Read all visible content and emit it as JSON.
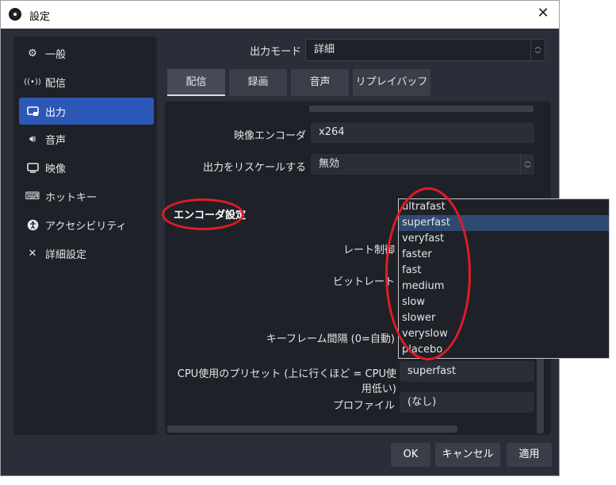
{
  "window": {
    "title": "設定"
  },
  "sidebar": {
    "items": [
      {
        "label": "一般",
        "icon": "gear-icon"
      },
      {
        "label": "配信",
        "icon": "broadcast-icon"
      },
      {
        "label": "出力",
        "icon": "output-icon",
        "active": true
      },
      {
        "label": "音声",
        "icon": "speaker-icon"
      },
      {
        "label": "映像",
        "icon": "monitor-icon"
      },
      {
        "label": "ホットキー",
        "icon": "keyboard-icon"
      },
      {
        "label": "アクセシビリティ",
        "icon": "accessibility-icon"
      },
      {
        "label": "詳細設定",
        "icon": "tools-icon"
      }
    ]
  },
  "output_mode": {
    "label": "出力モード",
    "value": "詳細"
  },
  "tabs": [
    "配信",
    "録画",
    "音声",
    "リプレイバッファ"
  ],
  "settings": {
    "video_encoder": {
      "label": "映像エンコーダ",
      "value": "x264"
    },
    "rescale": {
      "label": "出力をリスケールする",
      "value": "無効"
    },
    "encoder_section": "エンコーダ設定",
    "rate_control": {
      "label": "レート制御"
    },
    "bitrate": {
      "label": "ビットレート"
    },
    "keyframe": {
      "label": "キーフレーム間隔 (0=自動)"
    },
    "cpu_preset": {
      "label": "CPU使用のプリセット (上に行くほど = CPU使用低い)",
      "value": "superfast"
    },
    "profile": {
      "label": "プロファイル",
      "value": "(なし)"
    }
  },
  "preset_dropdown": {
    "options": [
      "ultrafast",
      "superfast",
      "veryfast",
      "faster",
      "fast",
      "medium",
      "slow",
      "slower",
      "veryslow",
      "placebo"
    ],
    "selected": "superfast"
  },
  "buttons": {
    "ok": "OK",
    "cancel": "キャンセル",
    "apply": "適用"
  },
  "colors": {
    "accent": "#2c58b7",
    "annotation": "#e31b23",
    "background": "#2b2e38"
  }
}
